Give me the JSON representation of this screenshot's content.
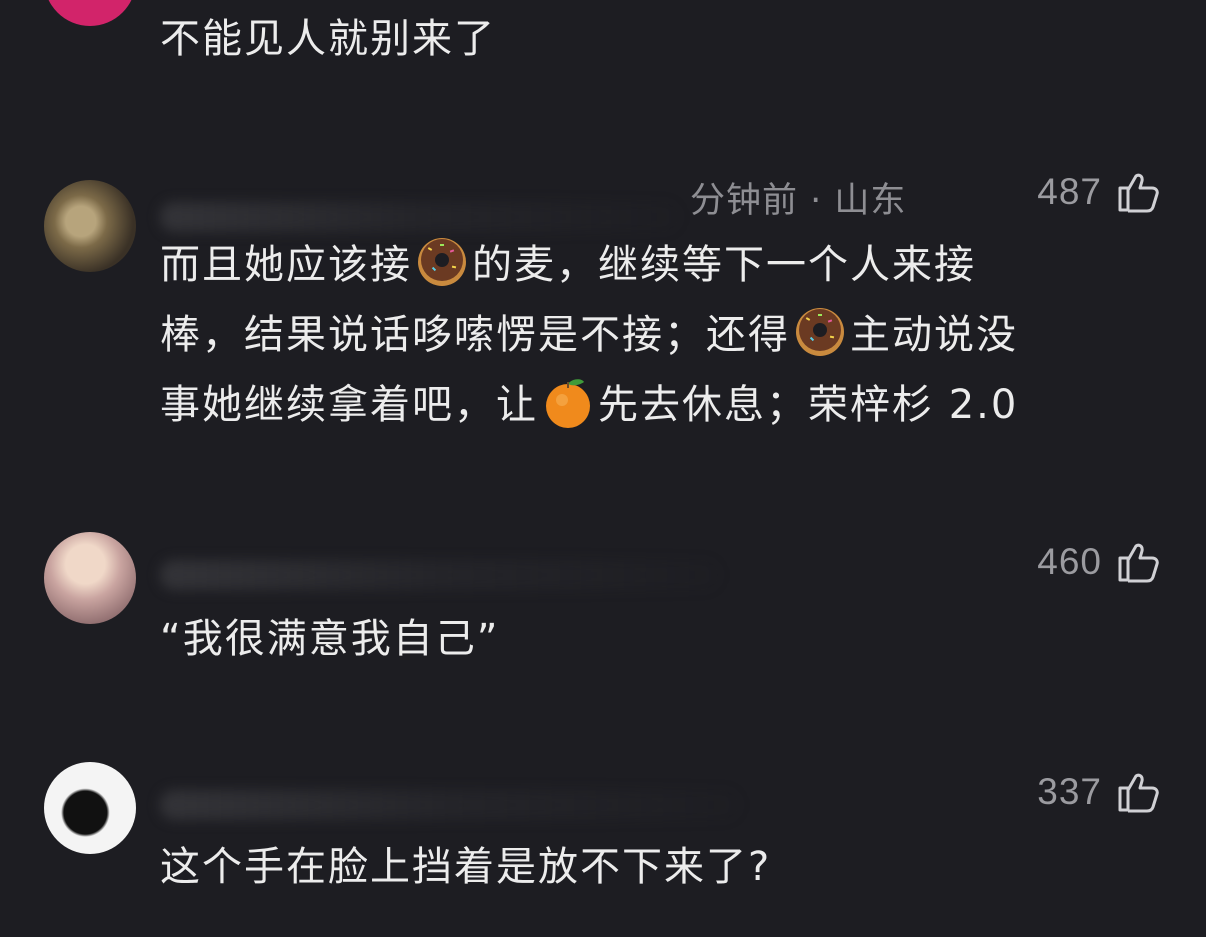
{
  "comments": [
    {
      "id": "c0",
      "text_lines": [
        "不能见人就别来了"
      ]
    },
    {
      "id": "c1",
      "meta": "分钟前 · 山东",
      "likes": "487",
      "line1_a": "而且她应该接",
      "line1_b": "的麦，继续等下一个人来接",
      "line2_a": "棒，结果说话哆嗦愣是不接；还得",
      "line2_b": "主动说没",
      "line3_a": "事她继续拿着吧，让",
      "line3_b": "先去休息；荣梓杉 2.0",
      "emojis": [
        "donut-emoji",
        "donut-emoji",
        "orange-emoji"
      ]
    },
    {
      "id": "c2",
      "likes": "460",
      "text_lines": [
        "“我很满意我自己”"
      ]
    },
    {
      "id": "c3",
      "likes": "337",
      "text_lines": [
        "这个手在脸上挡着是放不下来了?"
      ]
    }
  ],
  "icons": {
    "like": "thumbs-up-outline-icon"
  },
  "colors": {
    "background": "#1d1d22",
    "text": "#ececec",
    "meta": "#8e8e93"
  }
}
